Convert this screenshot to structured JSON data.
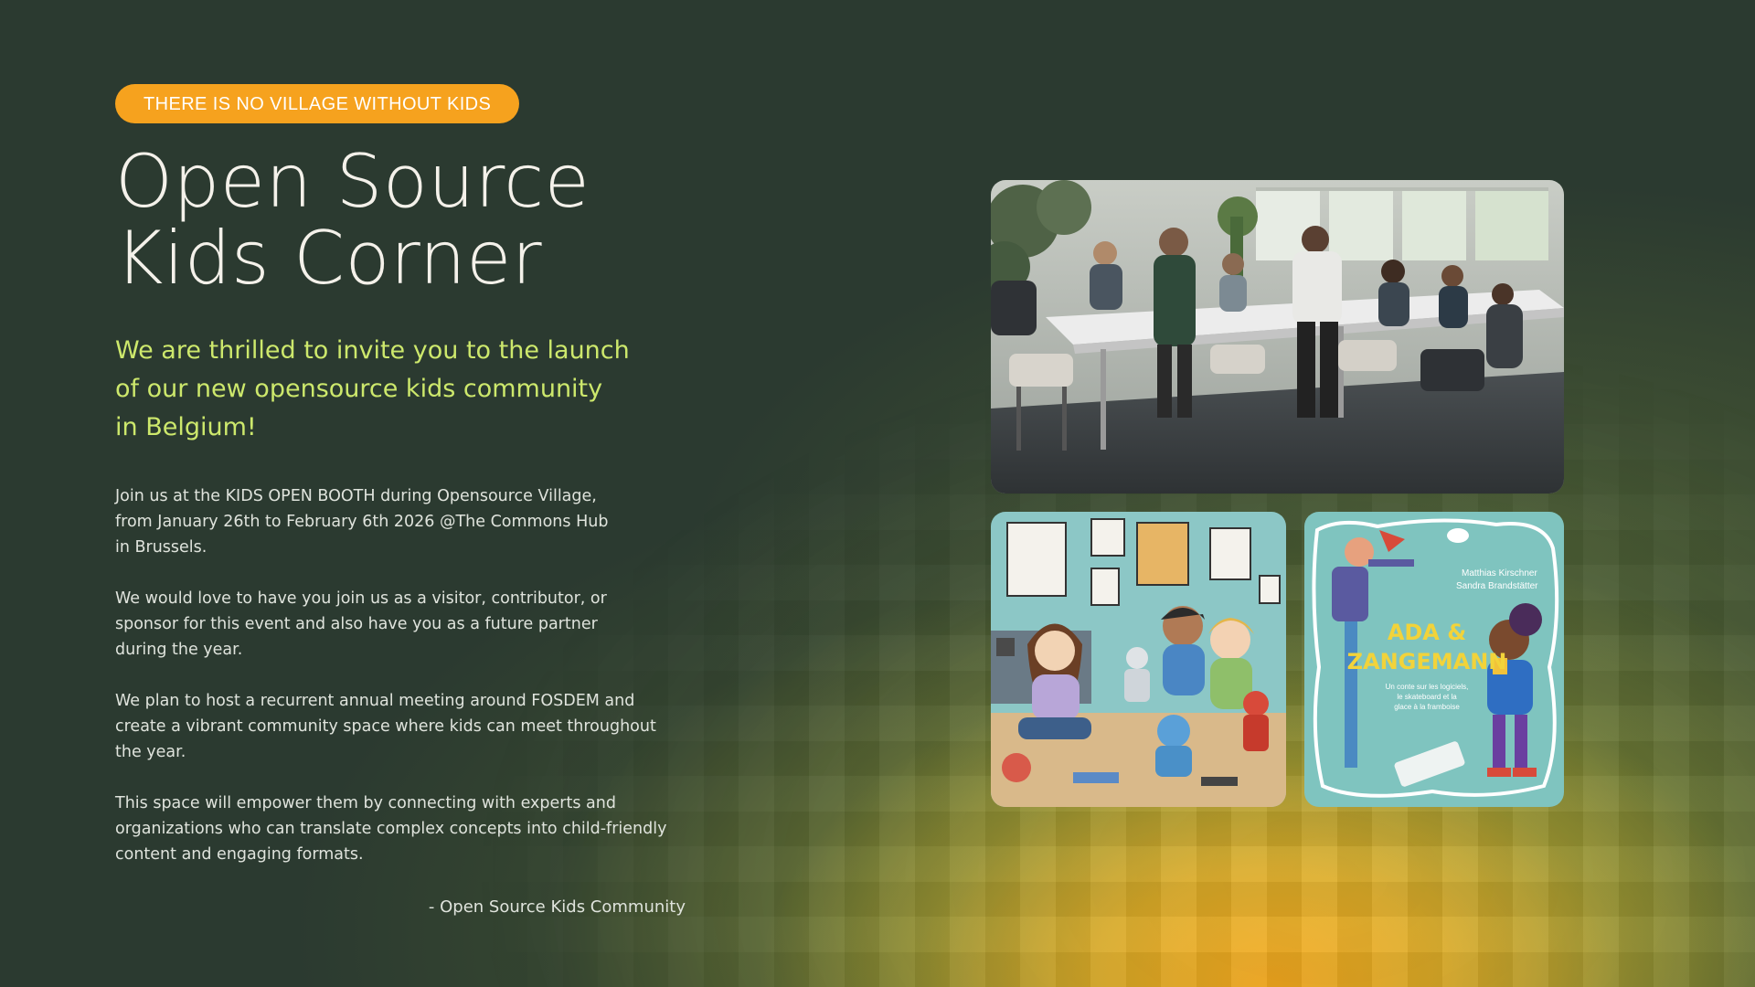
{
  "pill": "THERE IS NO VILLAGE WITHOUT KIDS",
  "title": {
    "line1": "Open Source",
    "line2": "Kids Corner"
  },
  "subtitle": {
    "line1": "We are thrilled to invite you to the launch",
    "line2": "of our new opensource kids community",
    "line3": "in Belgium!"
  },
  "paragraphs": {
    "p1": {
      "l1": "Join us at the KIDS OPEN BOOTH during Opensource Village,",
      "l2": "from January 26th to February 6th 2026 @The Commons Hub",
      "l3": "in Brussels."
    },
    "p2": {
      "l1": "We would love to have you join us as a visitor, contributor, or",
      "l2": "sponsor for this event and also have you as a future partner",
      "l3": "during the year."
    },
    "p3": {
      "l1": "We plan to host a recurrent annual meeting around FOSDEM and",
      "l2": "create a vibrant community space where kids can meet throughout",
      "l3": "the year."
    },
    "p4": {
      "l1": "This space will empower them by connecting with experts and",
      "l2": "organizations who can translate complex concepts into child-friendly",
      "l3": "content and engaging formats."
    }
  },
  "signature": "- Open Source Kids Community",
  "book": {
    "authors_line1": "Matthias Kirschner",
    "authors_line2": "Sandra Brandstätter",
    "title_line1": "ADA &",
    "title_line2": "ZANGEMANN",
    "tagline_line1": "Un conte sur les logiciels,",
    "tagline_line2": "le skateboard et la",
    "tagline_line3": "glace à la framboise"
  },
  "colors": {
    "background": "#2b3a30",
    "pill": "#f6a21e",
    "title": "#f4f1ea",
    "subtitle": "#cde86c",
    "body_text": "#dfe3dc",
    "glow": "#f6a21e"
  }
}
